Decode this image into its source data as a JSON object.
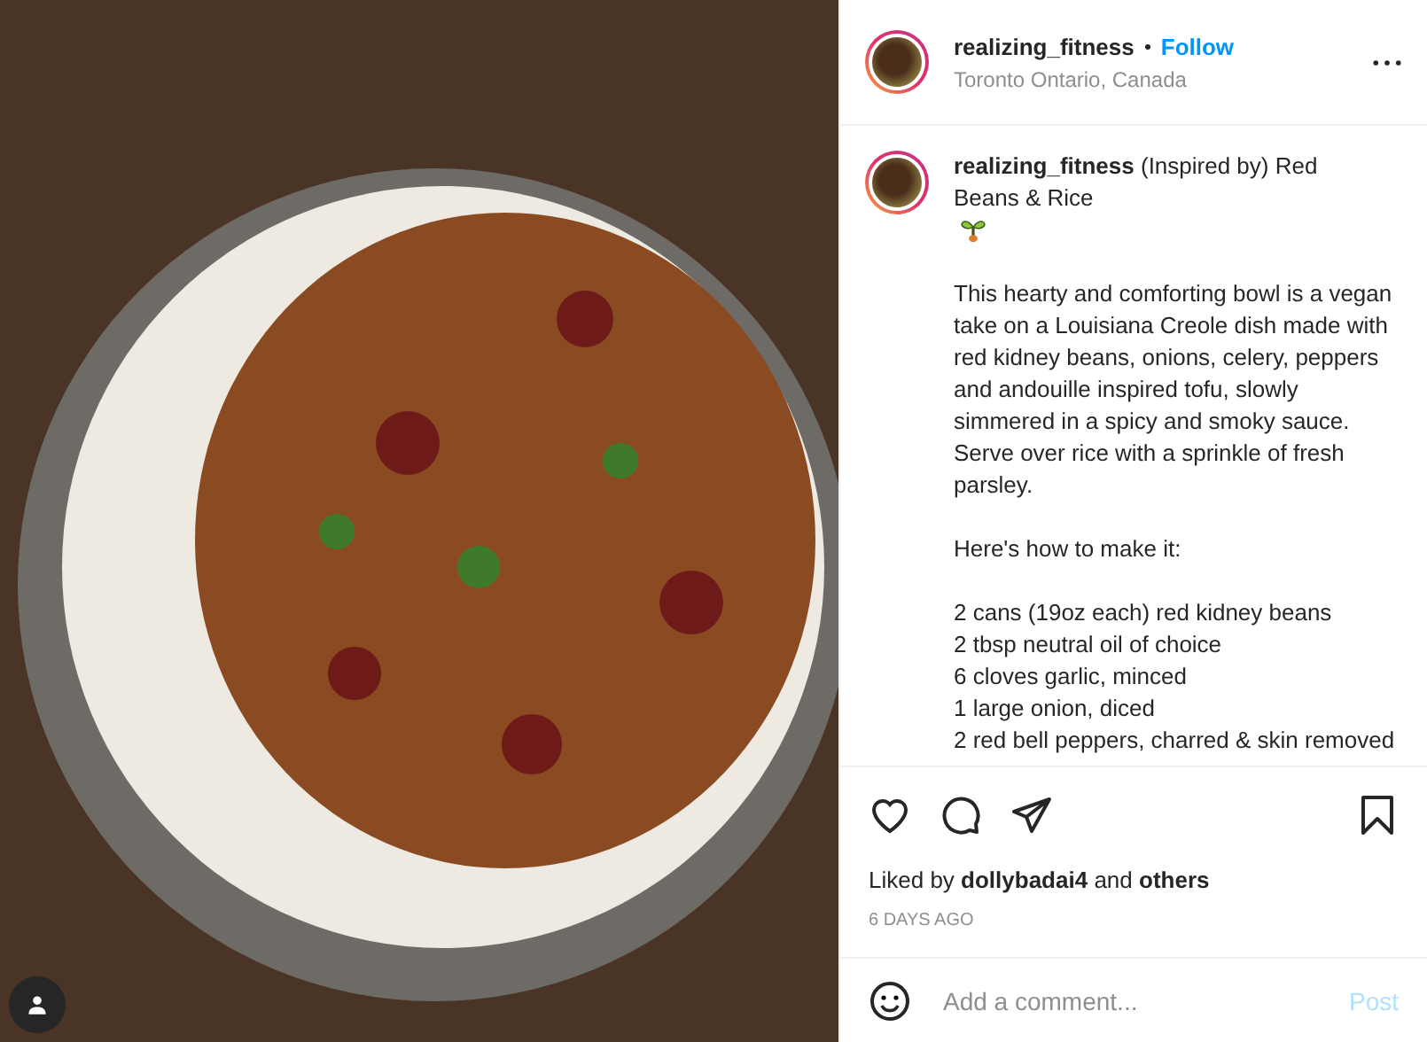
{
  "post": {
    "username": "realizing_fitness",
    "follow": "Follow",
    "location": "Toronto Ontario, Canada"
  },
  "caption": {
    "head": "**realizing_fitness** (Inspired by) Red Beans & Rice",
    "paragraphs": [
      "This hearty and comforting bowl is a vegan take on a Louisiana Creole dish made with red kidney beans, onions, celery, peppers and andouille inspired tofu, slowly simmered in a spicy and smoky sauce. Serve over rice with a sprinkle of fresh parsley.",
      "Here's how to make it:"
    ],
    "ingredients": [
      "2 cans (19oz each) red kidney beans",
      "2 tbsp neutral oil of choice",
      "6 cloves garlic, minced",
      "1 large onion, diced",
      "2 red bell peppers, charred & skin removed"
    ]
  },
  "likes": "Liked by **dollybadai4** and **others**",
  "date": "6 DAYS AGO",
  "comment": {
    "placeholder": "Add a comment...",
    "post_button": "Post",
    "disabled": true
  }
}
